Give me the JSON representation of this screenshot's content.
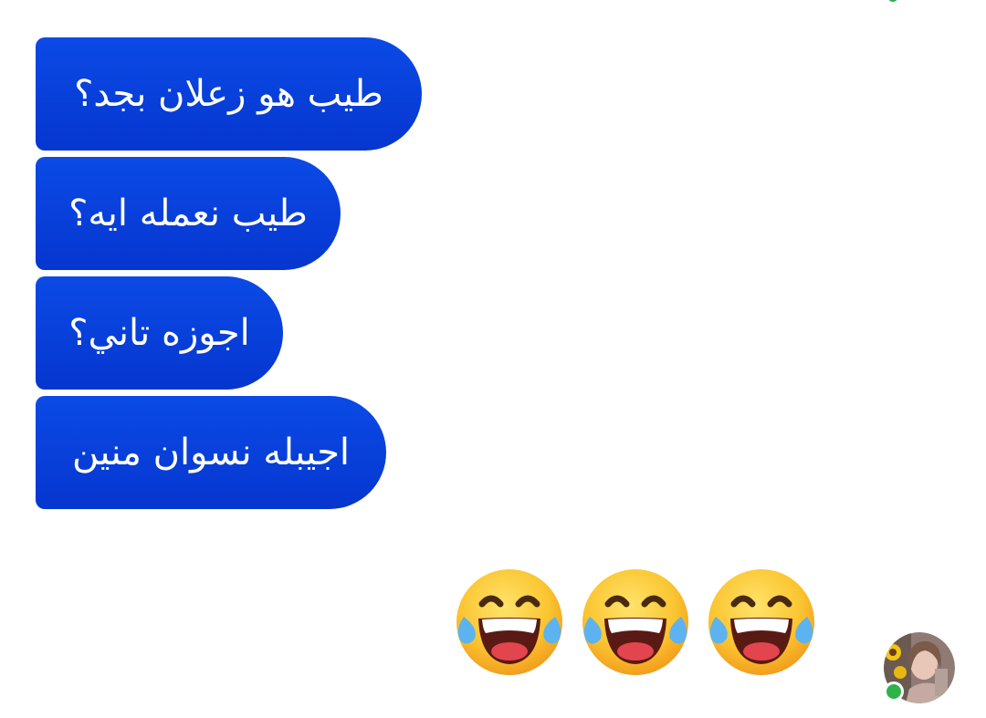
{
  "messages": [
    {
      "text": "طيب هو زعلان بجد؟"
    },
    {
      "text": "طيب نعمله ايه؟"
    },
    {
      "text": "اجوزه تاني؟"
    },
    {
      "text": "اجيبله نسوان منين"
    }
  ],
  "reply": {
    "emojis": [
      "😂",
      "😂",
      "😂"
    ],
    "emoji_name": "face-with-tears-of-joy"
  },
  "contact": {
    "status": "online"
  },
  "colors": {
    "bubble": "#0b4ae6",
    "bubble_text": "#ffffff",
    "online": "#2db34a"
  }
}
